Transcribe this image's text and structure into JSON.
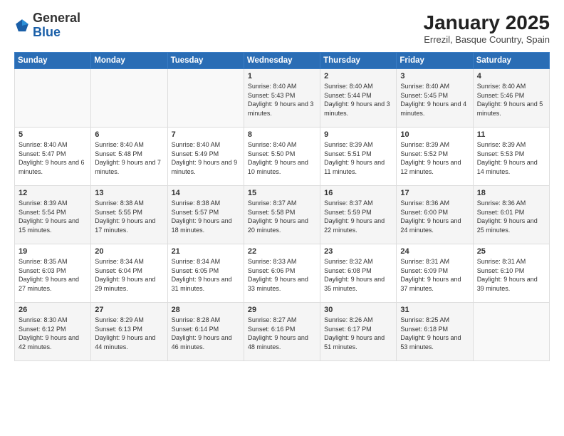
{
  "logo": {
    "general": "General",
    "blue": "Blue"
  },
  "header": {
    "month": "January 2025",
    "location": "Errezil, Basque Country, Spain"
  },
  "weekdays": [
    "Sunday",
    "Monday",
    "Tuesday",
    "Wednesday",
    "Thursday",
    "Friday",
    "Saturday"
  ],
  "weeks": [
    [
      {
        "day": "",
        "text": ""
      },
      {
        "day": "",
        "text": ""
      },
      {
        "day": "",
        "text": ""
      },
      {
        "day": "1",
        "text": "Sunrise: 8:40 AM\nSunset: 5:43 PM\nDaylight: 9 hours and 3 minutes."
      },
      {
        "day": "2",
        "text": "Sunrise: 8:40 AM\nSunset: 5:44 PM\nDaylight: 9 hours and 3 minutes."
      },
      {
        "day": "3",
        "text": "Sunrise: 8:40 AM\nSunset: 5:45 PM\nDaylight: 9 hours and 4 minutes."
      },
      {
        "day": "4",
        "text": "Sunrise: 8:40 AM\nSunset: 5:46 PM\nDaylight: 9 hours and 5 minutes."
      }
    ],
    [
      {
        "day": "5",
        "text": "Sunrise: 8:40 AM\nSunset: 5:47 PM\nDaylight: 9 hours and 6 minutes."
      },
      {
        "day": "6",
        "text": "Sunrise: 8:40 AM\nSunset: 5:48 PM\nDaylight: 9 hours and 7 minutes."
      },
      {
        "day": "7",
        "text": "Sunrise: 8:40 AM\nSunset: 5:49 PM\nDaylight: 9 hours and 9 minutes."
      },
      {
        "day": "8",
        "text": "Sunrise: 8:40 AM\nSunset: 5:50 PM\nDaylight: 9 hours and 10 minutes."
      },
      {
        "day": "9",
        "text": "Sunrise: 8:39 AM\nSunset: 5:51 PM\nDaylight: 9 hours and 11 minutes."
      },
      {
        "day": "10",
        "text": "Sunrise: 8:39 AM\nSunset: 5:52 PM\nDaylight: 9 hours and 12 minutes."
      },
      {
        "day": "11",
        "text": "Sunrise: 8:39 AM\nSunset: 5:53 PM\nDaylight: 9 hours and 14 minutes."
      }
    ],
    [
      {
        "day": "12",
        "text": "Sunrise: 8:39 AM\nSunset: 5:54 PM\nDaylight: 9 hours and 15 minutes."
      },
      {
        "day": "13",
        "text": "Sunrise: 8:38 AM\nSunset: 5:55 PM\nDaylight: 9 hours and 17 minutes."
      },
      {
        "day": "14",
        "text": "Sunrise: 8:38 AM\nSunset: 5:57 PM\nDaylight: 9 hours and 18 minutes."
      },
      {
        "day": "15",
        "text": "Sunrise: 8:37 AM\nSunset: 5:58 PM\nDaylight: 9 hours and 20 minutes."
      },
      {
        "day": "16",
        "text": "Sunrise: 8:37 AM\nSunset: 5:59 PM\nDaylight: 9 hours and 22 minutes."
      },
      {
        "day": "17",
        "text": "Sunrise: 8:36 AM\nSunset: 6:00 PM\nDaylight: 9 hours and 24 minutes."
      },
      {
        "day": "18",
        "text": "Sunrise: 8:36 AM\nSunset: 6:01 PM\nDaylight: 9 hours and 25 minutes."
      }
    ],
    [
      {
        "day": "19",
        "text": "Sunrise: 8:35 AM\nSunset: 6:03 PM\nDaylight: 9 hours and 27 minutes."
      },
      {
        "day": "20",
        "text": "Sunrise: 8:34 AM\nSunset: 6:04 PM\nDaylight: 9 hours and 29 minutes."
      },
      {
        "day": "21",
        "text": "Sunrise: 8:34 AM\nSunset: 6:05 PM\nDaylight: 9 hours and 31 minutes."
      },
      {
        "day": "22",
        "text": "Sunrise: 8:33 AM\nSunset: 6:06 PM\nDaylight: 9 hours and 33 minutes."
      },
      {
        "day": "23",
        "text": "Sunrise: 8:32 AM\nSunset: 6:08 PM\nDaylight: 9 hours and 35 minutes."
      },
      {
        "day": "24",
        "text": "Sunrise: 8:31 AM\nSunset: 6:09 PM\nDaylight: 9 hours and 37 minutes."
      },
      {
        "day": "25",
        "text": "Sunrise: 8:31 AM\nSunset: 6:10 PM\nDaylight: 9 hours and 39 minutes."
      }
    ],
    [
      {
        "day": "26",
        "text": "Sunrise: 8:30 AM\nSunset: 6:12 PM\nDaylight: 9 hours and 42 minutes."
      },
      {
        "day": "27",
        "text": "Sunrise: 8:29 AM\nSunset: 6:13 PM\nDaylight: 9 hours and 44 minutes."
      },
      {
        "day": "28",
        "text": "Sunrise: 8:28 AM\nSunset: 6:14 PM\nDaylight: 9 hours and 46 minutes."
      },
      {
        "day": "29",
        "text": "Sunrise: 8:27 AM\nSunset: 6:16 PM\nDaylight: 9 hours and 48 minutes."
      },
      {
        "day": "30",
        "text": "Sunrise: 8:26 AM\nSunset: 6:17 PM\nDaylight: 9 hours and 51 minutes."
      },
      {
        "day": "31",
        "text": "Sunrise: 8:25 AM\nSunset: 6:18 PM\nDaylight: 9 hours and 53 minutes."
      },
      {
        "day": "",
        "text": ""
      }
    ]
  ]
}
